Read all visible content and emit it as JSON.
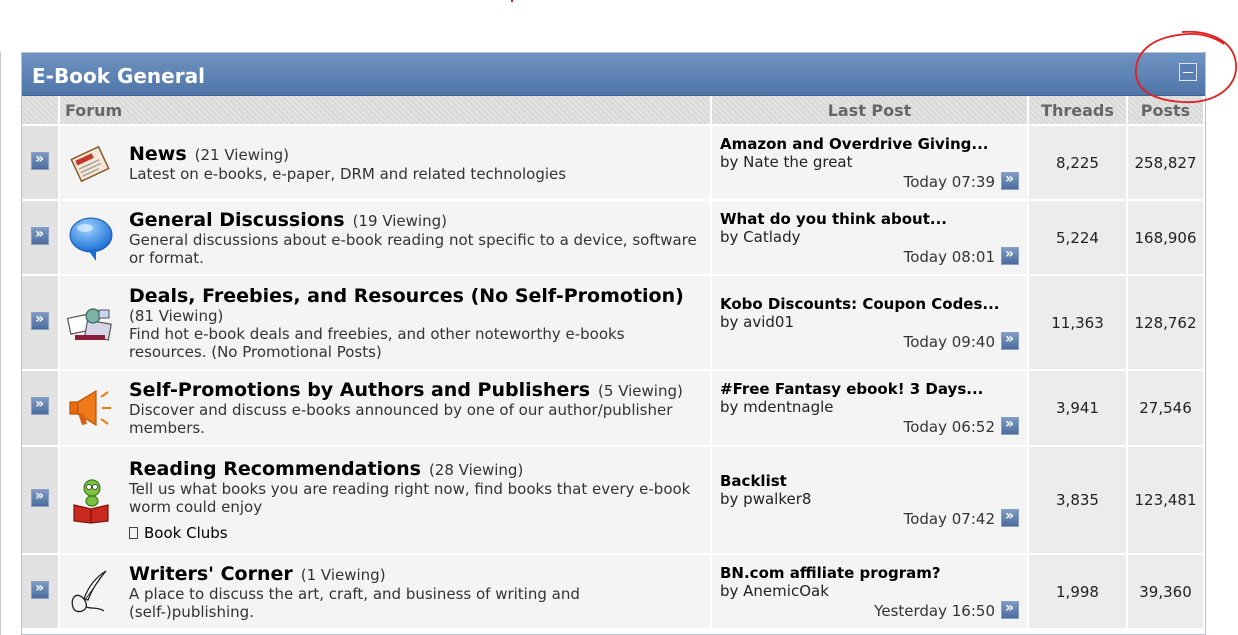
{
  "category": {
    "title": "E-Book General"
  },
  "columns": {
    "forum": "Forum",
    "last_post": "Last Post",
    "threads": "Threads",
    "posts": "Posts"
  },
  "forums": [
    {
      "name": "News",
      "viewing": "(21 Viewing)",
      "description": "Latest on e-books, e-paper, DRM and related technologies",
      "icon": "newspaper-icon",
      "last_post": {
        "title": "Amazon and Overdrive Giving...",
        "by": "by Nate the great",
        "time": "Today 07:39"
      },
      "threads": "8,225",
      "posts": "258,827"
    },
    {
      "name": "General Discussions",
      "viewing": "(19 Viewing)",
      "description": "General discussions about e-book reading not specific to a device, software or format.",
      "icon": "speech-bubble-icon",
      "last_post": {
        "title": "What do you think about...",
        "by": "by Catlady",
        "time": "Today 08:01"
      },
      "threads": "5,224",
      "posts": "168,906"
    },
    {
      "name": "Deals, Freebies, and Resources (No Self-Promotion)",
      "viewing": "(81 Viewing)",
      "description": "Find hot e-book deals and freebies, and other noteworthy e-books resources. (No Promotional Posts)",
      "icon": "deals-icon",
      "last_post": {
        "title": "Kobo Discounts: Coupon Codes...",
        "by": "by avid01",
        "time": "Today 09:40"
      },
      "threads": "11,363",
      "posts": "128,762"
    },
    {
      "name": "Self-Promotions by Authors and Publishers",
      "viewing": "(5 Viewing)",
      "description": "Discover and discuss e-books announced by one of our author/publisher members.",
      "icon": "megaphone-icon",
      "last_post": {
        "title": "#Free Fantasy ebook! 3 Days...",
        "by": "by mdentnagle",
        "time": "Today 06:52"
      },
      "threads": "3,941",
      "posts": "27,546"
    },
    {
      "name": "Reading Recommendations",
      "viewing": "(28 Viewing)",
      "description": "Tell us what books you are reading right now, find books that every e-book worm could enjoy",
      "subforum": "Book Clubs",
      "icon": "bookworm-icon",
      "last_post": {
        "title": "Backlist",
        "by": "by pwalker8",
        "time": "Today 07:42"
      },
      "threads": "3,835",
      "posts": "123,481"
    },
    {
      "name": "Writers' Corner",
      "viewing": "(1 Viewing)",
      "description": "A place to discuss the art, craft, and business of writing and (self-)publishing.",
      "icon": "quill-pen-icon",
      "last_post": {
        "title": "BN.com affiliate program?",
        "by": "by AnemicOak",
        "time": "Yesterday 16:50"
      },
      "threads": "1,998",
      "posts": "39,360"
    }
  ]
}
